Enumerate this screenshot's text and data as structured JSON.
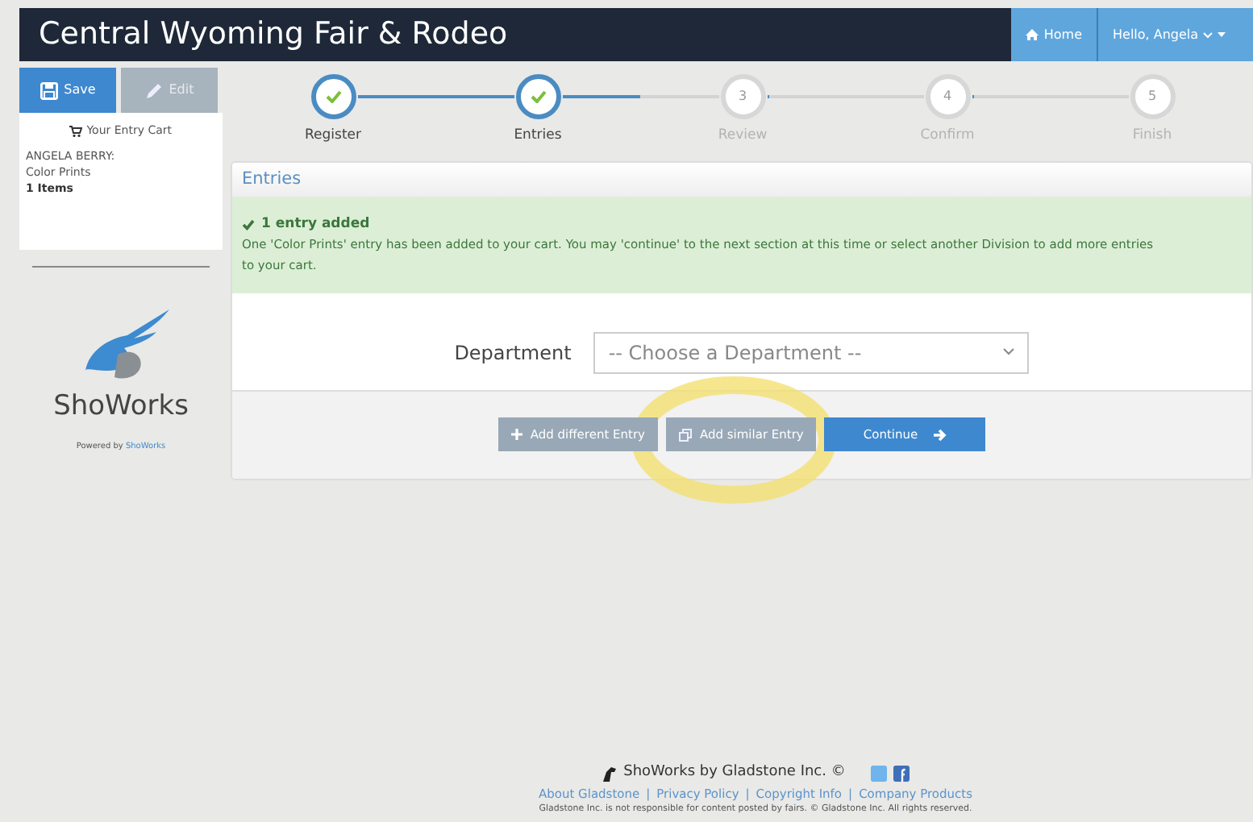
{
  "navbar": {
    "title": "Central Wyoming Fair & Rodeo",
    "home": "Home",
    "user_menu": "Hello, Angela"
  },
  "sidebar": {
    "save": {
      "label": "Save",
      "disabled": false
    },
    "edit": {
      "label": "Edit",
      "disabled": true
    },
    "cart": {
      "title": "Your Entry Cart",
      "exhibitor": "ANGELA BERRY:",
      "division": "Color Prints",
      "count": "1 Items"
    },
    "logo": "ShoWorks",
    "powered_by": "Powered by",
    "powered_link": "ShoWorks"
  },
  "steps": [
    {
      "label": "Register",
      "done": true
    },
    {
      "label": "Entries",
      "done": true
    },
    {
      "number": "3",
      "label": "Review",
      "done": false
    },
    {
      "number": "4",
      "label": "Confirm",
      "done": false
    },
    {
      "number": "5",
      "label": "Finish",
      "done": false
    }
  ],
  "connectors": [
    {
      "level": 1
    },
    {
      "level": 0.5
    },
    {
      "level": 0
    },
    {
      "level": 0
    }
  ],
  "panel": {
    "title": "Entries",
    "alert": {
      "heading": "1 entry added",
      "text": "One 'Color Prints' entry has been added to your cart. You may 'continue' to the next section at this time or select another Division to add more entries to your cart."
    },
    "department": {
      "label": "Department",
      "placeholder": "-- Choose a Department --"
    },
    "buttons": [
      {
        "label": "Add different Entry",
        "kind": "secondary"
      },
      {
        "label": "Add similar Entry",
        "kind": "secondary"
      },
      {
        "label": "Continue",
        "kind": "primary"
      }
    ]
  },
  "annotation": {
    "kind": "highlight"
  },
  "footer": {
    "brand": "ShoWorks by Gladstone Inc. ©",
    "links": [
      "About Gladstone",
      "Privacy Policy",
      "Copyright Info",
      "Company Products"
    ],
    "separator": "|",
    "disclaimer": "Gladstone Inc. is not responsible for content posted by fairs. © Gladstone Inc. All rights reserved."
  }
}
